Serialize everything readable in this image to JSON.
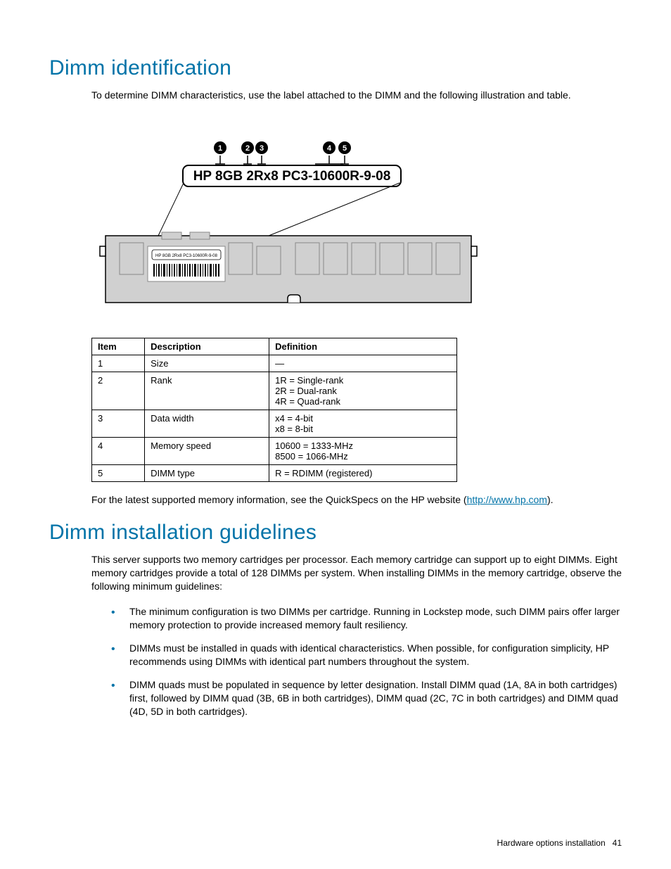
{
  "section1": {
    "heading": "Dimm identification",
    "intro": "To determine DIMM characteristics, use the label attached to the DIMM and the following illustration and table.",
    "label_text": "HP 8GB 2Rx8 PC3-10600R-9-08",
    "label_small": "HP 8GB 2Rx8 PC3-10600R-9-08",
    "callouts": [
      "1",
      "2",
      "3",
      "4",
      "5"
    ],
    "table": {
      "headers": {
        "col1": "Item",
        "col2": "Description",
        "col3": "Definition"
      },
      "rows": [
        {
          "item": "1",
          "desc": "Size",
          "def": [
            "—"
          ]
        },
        {
          "item": "2",
          "desc": "Rank",
          "def": [
            "1R = Single-rank",
            "2R = Dual-rank",
            "4R = Quad-rank"
          ]
        },
        {
          "item": "3",
          "desc": "Data width",
          "def": [
            "x4 = 4-bit",
            "x8 = 8-bit"
          ]
        },
        {
          "item": "4",
          "desc": "Memory speed",
          "def": [
            "10600 = 1333-MHz",
            "8500 = 1066-MHz"
          ]
        },
        {
          "item": "5",
          "desc": "DIMM type",
          "def": [
            "R = RDIMM (registered)"
          ]
        }
      ]
    },
    "outro_pre": "For the latest supported memory information, see the QuickSpecs on the HP website (",
    "outro_link": "http://www.hp.com",
    "outro_post": ")."
  },
  "section2": {
    "heading": "Dimm installation guidelines",
    "intro": "This server supports two memory cartridges per processor. Each memory cartridge can support up to eight DIMMs. Eight memory cartridges provide a total of 128 DIMMs per system. When installing DIMMs in the memory cartridge, observe the following minimum guidelines:",
    "bullets": [
      "The minimum configuration is two DIMMs per cartridge. Running in Lockstep mode, such DIMM pairs offer larger memory protection to provide increased memory fault resiliency.",
      "DIMMs must be installed in quads with identical characteristics. When possible, for configuration simplicity, HP recommends using DIMMs with identical part numbers throughout the system.",
      "DIMM quads must be populated in sequence by letter designation. Install DIMM quad (1A, 8A in both cartridges) first, followed by DIMM quad (3B, 6B in both cartridges), DIMM quad (2C, 7C in both cartridges) and DIMM quad (4D, 5D in both cartridges)."
    ]
  },
  "footer": {
    "text": "Hardware options installation",
    "page": "41"
  }
}
